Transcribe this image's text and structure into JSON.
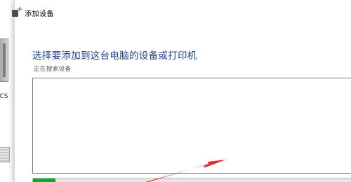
{
  "background_window": {
    "device_label": "PCS"
  },
  "dialog": {
    "title": "添加设备",
    "heading": "选择要添加到这台电脑的设备或打印机",
    "status_text": "正在搜索设备",
    "device_list": {
      "items": []
    },
    "progress": {
      "fraction": 0.07,
      "color": "#06b025"
    }
  },
  "colors": {
    "heading": "#1a3f8f",
    "annotation_arrow": "#e8262b"
  },
  "icons": {
    "title_icon": "add-device-icon",
    "background_icon": "computer-icon",
    "background_printer": "printer-icon"
  }
}
